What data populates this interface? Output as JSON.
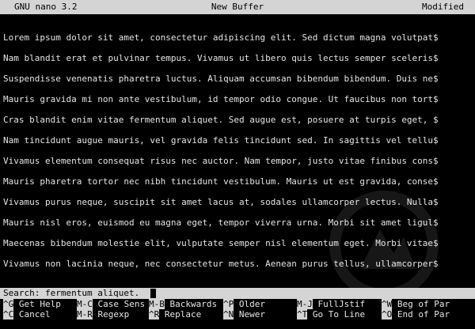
{
  "titlebar": {
    "version": "GNU nano 3.2",
    "buffer": "New Buffer",
    "status": "Modified"
  },
  "lines": [
    "Lorem ipsum dolor sit amet, consectetur adipiscing elit. Sed dictum magna volutpat$",
    "Nam blandit erat et pulvinar tempus. Vivamus ut libero quis lectus semper sceleris$",
    "Suspendisse venenatis pharetra luctus. Aliquam accumsan bibendum bibendum. Duis ne$",
    "Mauris gravida mi non ante vestibulum, id tempor odio congue. Ut faucibus non tort$",
    "Cras blandit enim vitae fermentum aliquet. Sed augue est, posuere at turpis eget, $",
    "Nam tincidunt augue mauris, vel gravida felis tincidunt sed. In sagittis vel tellu$",
    "Vivamus elementum consequat risus nec auctor. Nam tempor, justo vitae finibus cons$",
    "Mauris pharetra tortor nec nibh tincidunt vestibulum. Mauris ut est gravida, conse$",
    "Vivamus purus neque, suscipit sit amet lacus at, sodales ullamcorper lectus. Nulla$",
    "Mauris nisl eros, euismod eu magna eget, tempor viverra urna. Morbi sit amet ligul$",
    "Maecenas bibendum molestie elit, vulputate semper nisl elementum eget. Morbi vitae$",
    "Vivamus non lacinia neque, nec consectetur metus. Aenean purus tellus, ullamcorper$"
  ],
  "search": {
    "prompt": "Search: fermentum aliquet."
  },
  "shortcuts_row1": [
    {
      "key": "^G",
      "label": "Get Help"
    },
    {
      "key": "M-C",
      "label": "Case Sens"
    },
    {
      "key": "M-B",
      "label": "Backwards"
    },
    {
      "key": "^P",
      "label": "Older"
    },
    {
      "key": "M-J",
      "label": "FullJstif"
    },
    {
      "key": "^W",
      "label": "Beg of Par"
    }
  ],
  "shortcuts_row2": [
    {
      "key": "^C",
      "label": "Cancel"
    },
    {
      "key": "M-R",
      "label": "Regexp"
    },
    {
      "key": "^R",
      "label": "Replace"
    },
    {
      "key": "^N",
      "label": "Newer"
    },
    {
      "key": "^T",
      "label": "Go To Line"
    },
    {
      "key": "^O",
      "label": "End of Par"
    }
  ],
  "colors": {
    "background": "#000000",
    "text": "#e6e6e6",
    "bar": "#d4d4d4"
  }
}
